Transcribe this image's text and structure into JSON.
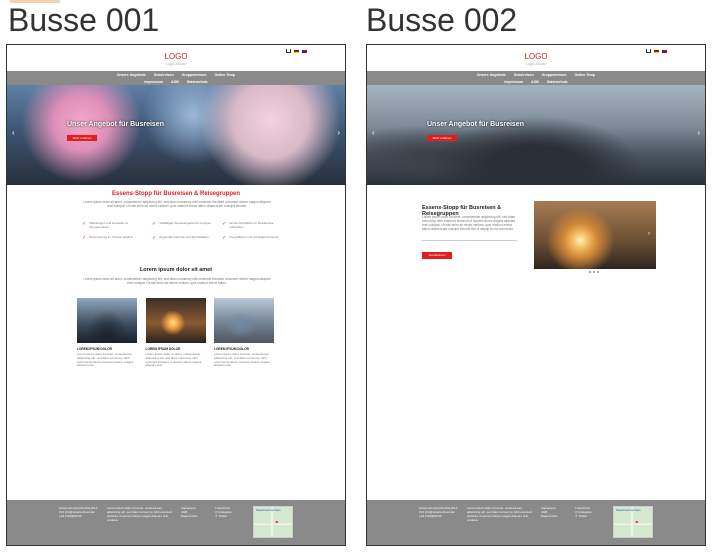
{
  "headings": {
    "left": "Busse 001",
    "right": "Busse 002"
  },
  "site": {
    "logo": "LOGO",
    "logo_sub": "Logo Zusatz",
    "nav_row1": [
      "Unsere Angebote",
      "Schulreisen",
      "Gruppenreisen",
      "Online Shop"
    ],
    "nav_row2": [
      "Impressum",
      "AGB",
      "Datenschutz"
    ],
    "hero_title": "Unser Angebot für Busreisen",
    "hero_button": "Mehr erfahren",
    "arrow_left": "‹",
    "arrow_right": "›"
  },
  "mock1": {
    "section_title": "Essens-Stopp für Busreisen & Reisegruppen",
    "section_text": "Lorem ipsum dolor sit amet, consectetuer adipiscing elit, sed diam nonummy nibh euismod tincidunt ut laoreet dolore magna aliquam erat volutpat. Ut wisi enim ad minim veniam, quis nostrud exerci tation ullamcorper suscipit lobortis.",
    "features": [
      "Mitteilungen und Hinweise zu Gruppenreisen",
      "Vielfältiges Speiseangebot für Gruppen",
      "Große Parkplätze für Reisebusse vorhanden",
      "Reservierung im Voraus möglich",
      "Regionale Gerichte und Spezialitäten",
      "Freundliches und schnelles Personal"
    ],
    "section_title2": "Lorem ipsum dolor sit amet",
    "section_text2": "Lorem ipsum dolor sit amet, consectetuer adipiscing elit, sed diam nonummy nibh euismod tincidunt ut laoreet dolore magna aliquam erat volutpat. Ut wisi enim ad minim veniam, quis nostrud exerci tation.",
    "cards": [
      {
        "title": "LOREM IPSUM DOLOR",
        "text": "Lorem ipsum dolor sit amet, consectetuer adipiscing elit, sed diam nonummy nibh euismod tincidunt ut laoreet dolore magna aliquam erat."
      },
      {
        "title": "LOREM IPSUM DOLOR",
        "text": "Lorem ipsum dolor sit amet, consectetuer adipiscing elit, sed diam nonummy nibh euismod tincidunt ut laoreet dolore magna aliquam erat."
      },
      {
        "title": "LOREM IPSUM DOLOR",
        "text": "Lorem ipsum dolor sit amet, consectetuer adipiscing elit, sed diam nonummy nibh euismod tincidunt ut laoreet dolore magna aliquam erat."
      }
    ]
  },
  "mock2": {
    "intro_title": "Essens-Stopp für Busreisen & Reisegruppen",
    "intro_text": "Lorem ipsum dolor sit amet, consectetuer adipiscing elit, sed diam nonummy nibh euismod tincidunt ut laoreet dolore magna aliquam erat volutpat. Ut wisi enim ad minim veniam, quis nostrud exerci tation ullamcorper suscipit lobortis nisl ut aliquip ex ea commodo.",
    "intro_button": "Kontaktieren"
  },
  "footer": {
    "address": "[Unternehmen] [Straße] [PLZ Ort] info@unternehmen.de +49 0 000000 00",
    "about": "Lorem ipsum dolor sit amet, consectetuer adipiscing elit, sed diam nonummy nibh euismod tincidunt ut laoreet dolore magna aliquam erat volutpat.",
    "links": [
      "Impressum",
      "AGB",
      "Datenschutz"
    ],
    "social": [
      "Facebook",
      "Instagram",
      "Twitter"
    ],
    "map_label": "Standort auf der Karte"
  }
}
